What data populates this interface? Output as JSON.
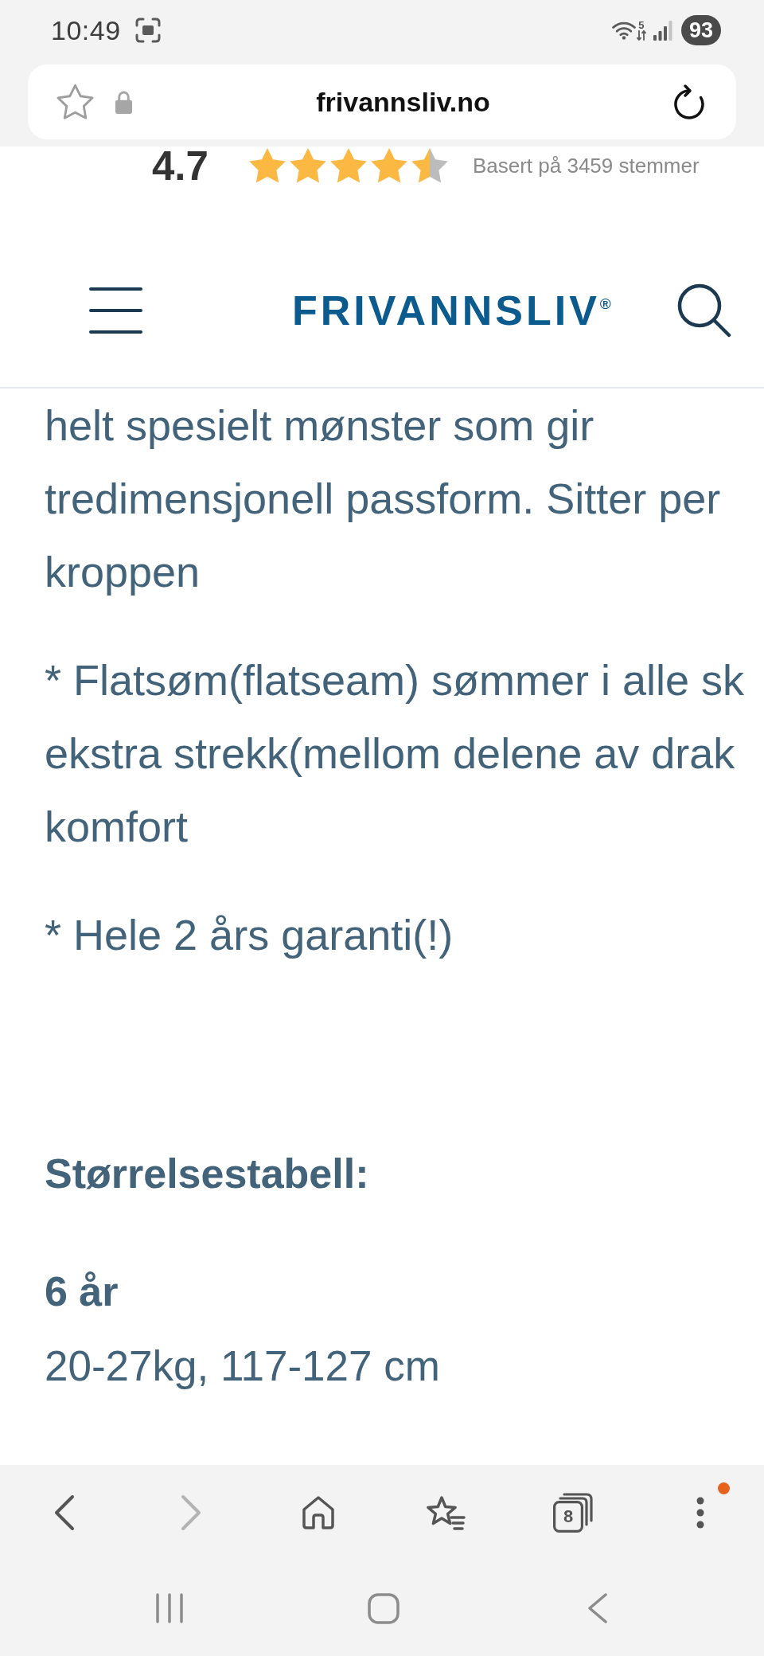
{
  "status_bar": {
    "time": "10:49",
    "wifi_band": "5",
    "battery": "93"
  },
  "address_bar": {
    "bookmarked": false,
    "url": "frivannsliv.no"
  },
  "rating": {
    "score": "4.7",
    "stars": 4.5,
    "caption": "Basert på 3459 stemmer"
  },
  "site_header": {
    "logo": "FRIVANNSLIV$^{®}$"
  },
  "article": {
    "blocks": [
      {
        "kind": "paragraph",
        "lines": [
          "helt spesielt mønster som gir",
          "tredimensjonell passform. Sitter per",
          "kroppen"
        ]
      },
      {
        "kind": "paragraph",
        "lines": [
          "* Flatsøm(flatseam) sømmer i alle sk",
          "ekstra strekk(mellom delene av drak",
          "komfort"
        ]
      },
      {
        "kind": "paragraph",
        "lines": [
          "* Hele 2 års garanti(!)"
        ]
      },
      {
        "kind": "heading",
        "text": "Størrelsestabell:"
      },
      {
        "kind": "size",
        "label": "6 år",
        "detail": "20-27kg, 117-127 cm"
      }
    ]
  },
  "browser_toolbar": {
    "buttons": [
      {
        "kind": "back",
        "disabled": false
      },
      {
        "kind": "forward",
        "disabled": true
      },
      {
        "kind": "home",
        "disabled": false
      },
      {
        "kind": "bookmarks",
        "disabled": false
      },
      {
        "kind": "tabs",
        "disabled": false,
        "count": "8"
      },
      {
        "kind": "more",
        "disabled": false,
        "notification": true
      }
    ]
  }
}
